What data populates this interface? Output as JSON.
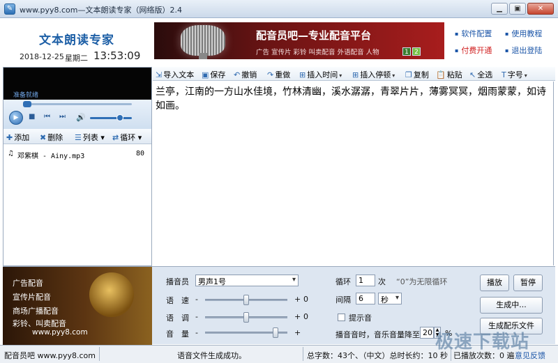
{
  "window": {
    "title": "www.pyy8.com—文本朗读专家（网络版）2.4",
    "controls": [
      "▁",
      "▣",
      "✕"
    ]
  },
  "header": {
    "brand": "文本朗读专家",
    "date": "2018-12-25",
    "weekday": "星期二",
    "time": "13:53:09",
    "banner": {
      "title": "配音员吧—专业配音平台",
      "subtitle": "广告  宣传片  彩铃  叫卖配音  外语配音  人物",
      "pages": [
        "1",
        "2"
      ]
    },
    "links": [
      {
        "label": "软件配置"
      },
      {
        "label": "使用教程"
      },
      {
        "label": "付费开通"
      },
      {
        "label": "退出登陆"
      }
    ]
  },
  "player": {
    "status": "准备就绪",
    "progress": 0.0,
    "volume": 0.7,
    "icons": {
      "play": "play-icon",
      "stop": "stop-icon",
      "prev": "prev-icon",
      "next": "next-icon",
      "volume": "volume-icon"
    }
  },
  "playlist_toolbar": {
    "add": "添加",
    "delete": "删除",
    "list": "列表",
    "loop": "循环"
  },
  "playlist": [
    {
      "name": "邓紫棋 - Ainy.mp3",
      "length": "80"
    }
  ],
  "toolbar": {
    "import": "导入文本",
    "save": "保存",
    "undo": "撤销",
    "redo": "重做",
    "insert_time": "插入时间",
    "insert_pause": "插入停顿",
    "copy": "复制",
    "paste": "粘贴",
    "select_all": "全选",
    "font": "字号"
  },
  "editor": {
    "text": "兰亭，江南的一方山水佳境，竹林清幽，溪水潺潺，青翠片片，薄雾冥冥，烟雨蒙蒙，如诗如画。"
  },
  "ad": {
    "lines": [
      "广告配音",
      "宣传片配音",
      "商场广播配音",
      "彩铃、叫卖配音"
    ],
    "url": "www.pyy8.com"
  },
  "settings": {
    "voice_label": "播音员",
    "voice_value": "男声1号",
    "speed_label": "语　速",
    "tone_label": "语　调",
    "volume_label": "音　量",
    "minus": "-",
    "plus": "+",
    "speed_value": "0",
    "tone_value": "0",
    "speed_level": 0.5,
    "tone_level": 0.5,
    "volume_level": 0.88,
    "loop_label": "循环",
    "loop_value": "1",
    "loop_unit": "次",
    "loop_hint": "“0”为无限循环",
    "interval_label": "间隔",
    "interval_value": "6",
    "interval_unit": "秒",
    "beep_label": "提示音",
    "music_label": "播音音时，音乐音量降至",
    "music_value": "20",
    "music_unit": "%"
  },
  "buttons": {
    "play": "播放",
    "pause": "暂停",
    "generating": "生成中...",
    "generate_music": "生成配乐文件"
  },
  "statusbar": {
    "site": "配音员吧  www.pyy8.com",
    "message": "语音文件生成成功。",
    "stats": "总字数：43个、（中文）总时长约：10 秒",
    "played": "已播放次数：0 遍",
    "feedback": "意见反馈"
  },
  "watermark": "极速下载站"
}
